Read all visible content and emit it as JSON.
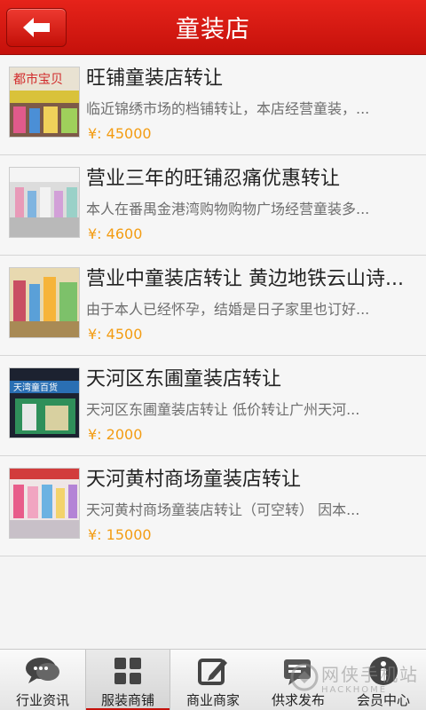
{
  "header": {
    "title": "童装店"
  },
  "listings": [
    {
      "title": "旺铺童装店转让",
      "desc": "临近锦绣市场的档铺转让，本店经营童装，...",
      "price": "¥: 45000"
    },
    {
      "title": "营业三年的旺铺忍痛优惠转让",
      "desc": "本人在番禺金港湾购物购物广场经营童装多...",
      "price": "¥: 4600"
    },
    {
      "title": "营业中童装店转让 黄边地铁云山诗...",
      "desc": "由于本人已经怀孕，结婚是日子家里也订好...",
      "price": "¥: 4500"
    },
    {
      "title": "天河区东圃童装店转让",
      "desc": "天河区东圃童装店转让 低价转让广州天河...",
      "price": "¥: 2000"
    },
    {
      "title": "天河黄村商场童装店转让",
      "desc": "天河黄村商场童装店转让（可空转） 因本...",
      "price": "¥: 15000"
    }
  ],
  "thumbs": [
    {
      "sign_text": "都市宝贝"
    },
    {
      "sign_text": ""
    },
    {
      "sign_text": ""
    },
    {
      "sign_text": "天湾童百货"
    },
    {
      "sign_text": ""
    }
  ],
  "tabs": [
    {
      "label": "行业资讯",
      "icon": "chat-bubbles-icon"
    },
    {
      "label": "服装商铺",
      "icon": "grid-icon"
    },
    {
      "label": "商业商家",
      "icon": "edit-icon"
    },
    {
      "label": "供求发布",
      "icon": "message-icon"
    },
    {
      "label": "会员中心",
      "icon": "info-icon"
    }
  ],
  "active_tab": 1,
  "watermark": {
    "text": "网侠手机站",
    "sub": "HACKHOME"
  },
  "colors": {
    "header_red": "#d41a12",
    "price": "#f39c12",
    "active_underline": "#c5110b"
  }
}
